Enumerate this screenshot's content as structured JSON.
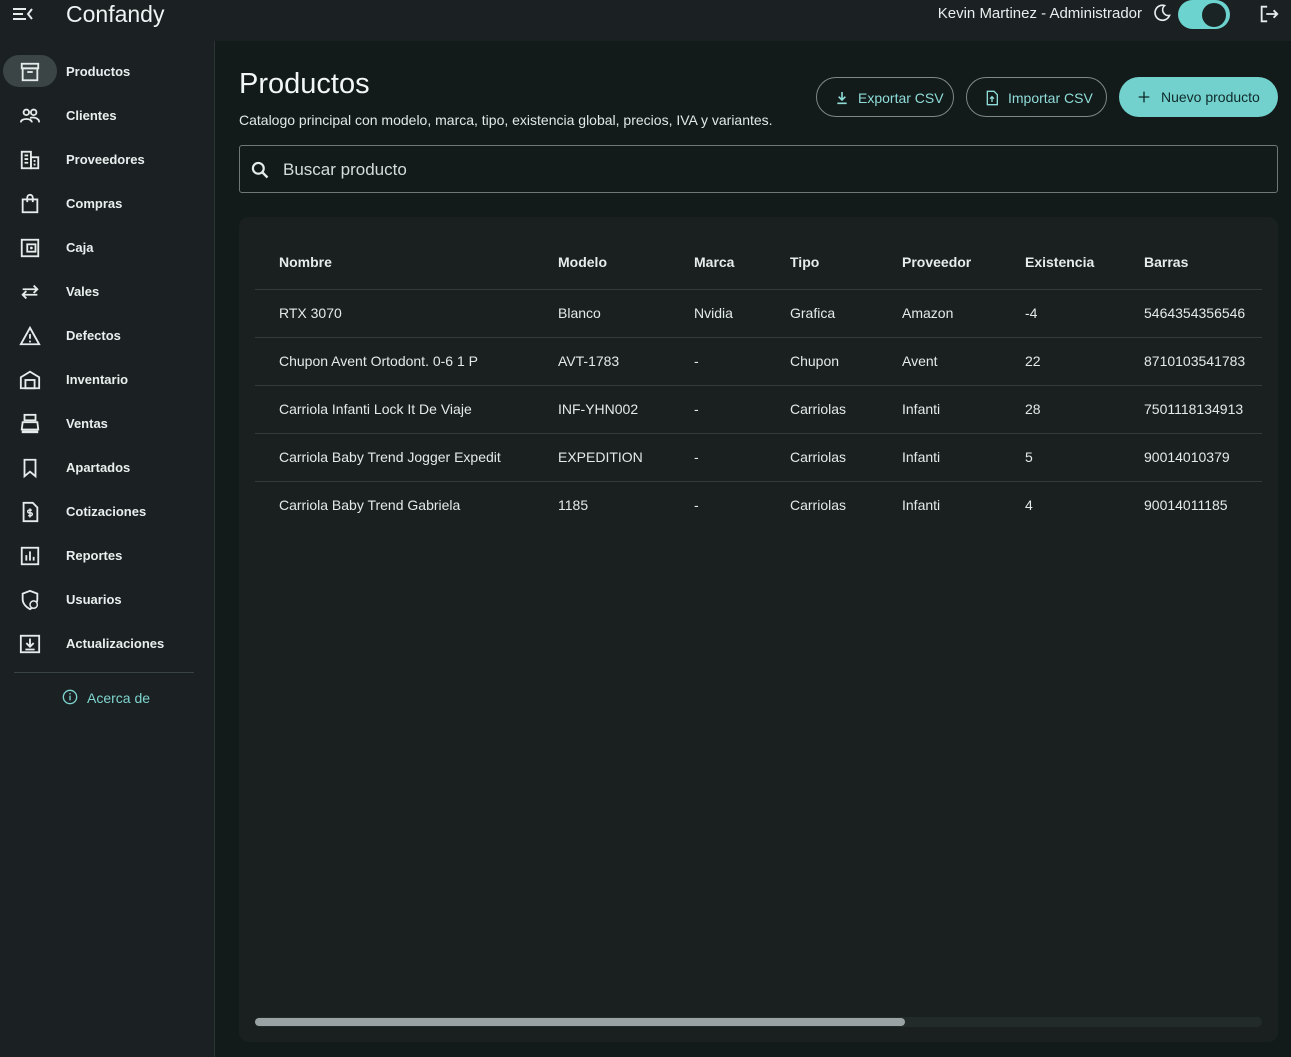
{
  "app": {
    "title": "Confandy",
    "user": "Kevin Martinez - Administrador"
  },
  "colors": {
    "accent": "#72d1cd",
    "background": "#121a1a",
    "sidebar": "#1b2122",
    "card": "#1a2020"
  },
  "icons": {
    "menu": "menu-collapse-icon",
    "theme": "moon-icon",
    "logout": "logout-icon",
    "search": "search-icon"
  },
  "sidebar": {
    "items": [
      {
        "label": "Productos",
        "icon": "archive-box-icon",
        "active": true
      },
      {
        "label": "Clientes",
        "icon": "users-icon"
      },
      {
        "label": "Proveedores",
        "icon": "building-icon"
      },
      {
        "label": "Compras",
        "icon": "shopping-bag-icon"
      },
      {
        "label": "Caja",
        "icon": "cash-register-icon"
      },
      {
        "label": "Vales",
        "icon": "swap-arrows-icon"
      },
      {
        "label": "Defectos",
        "icon": "warning-triangle-icon"
      },
      {
        "label": "Inventario",
        "icon": "warehouse-icon"
      },
      {
        "label": "Ventas",
        "icon": "point-of-sale-icon"
      },
      {
        "label": "Apartados",
        "icon": "bookmark-icon"
      },
      {
        "label": "Cotizaciones",
        "icon": "invoice-dollar-icon"
      },
      {
        "label": "Reportes",
        "icon": "bar-chart-icon"
      },
      {
        "label": "Usuarios",
        "icon": "shield-user-icon"
      },
      {
        "label": "Actualizaciones",
        "icon": "download-box-icon"
      }
    ],
    "about": "Acerca de"
  },
  "page": {
    "title": "Productos",
    "subtitle": "Catalogo principal con modelo, marca, tipo, existencia global, precios, IVA y variantes.",
    "actions": {
      "export": "Exportar CSV",
      "import": "Importar CSV",
      "new": "Nuevo producto"
    },
    "search_placeholder": "Buscar producto"
  },
  "table": {
    "columns": [
      "Nombre",
      "Modelo",
      "Marca",
      "Tipo",
      "Proveedor",
      "Existencia",
      "Barras"
    ],
    "rows": [
      [
        "RTX 3070",
        "Blanco",
        "Nvidia",
        "Grafica",
        "Amazon",
        "-4",
        "5464354356546"
      ],
      [
        "Chupon Avent Ortodont. 0-6 1 P",
        "AVT-1783",
        "-",
        "Chupon",
        "Avent",
        "22",
        "8710103541783"
      ],
      [
        "Carriola Infanti Lock It De Viaje",
        "INF-YHN002",
        "-",
        "Carriolas",
        "Infanti",
        "28",
        "7501118134913"
      ],
      [
        "Carriola Baby Trend Jogger Expedit",
        "EXPEDITION",
        "-",
        "Carriolas",
        "Infanti",
        "5",
        "90014010379"
      ],
      [
        "Carriola Baby Trend Gabriela",
        "1185",
        "-",
        "Carriolas",
        "Infanti",
        "4",
        "90014011185"
      ]
    ]
  }
}
